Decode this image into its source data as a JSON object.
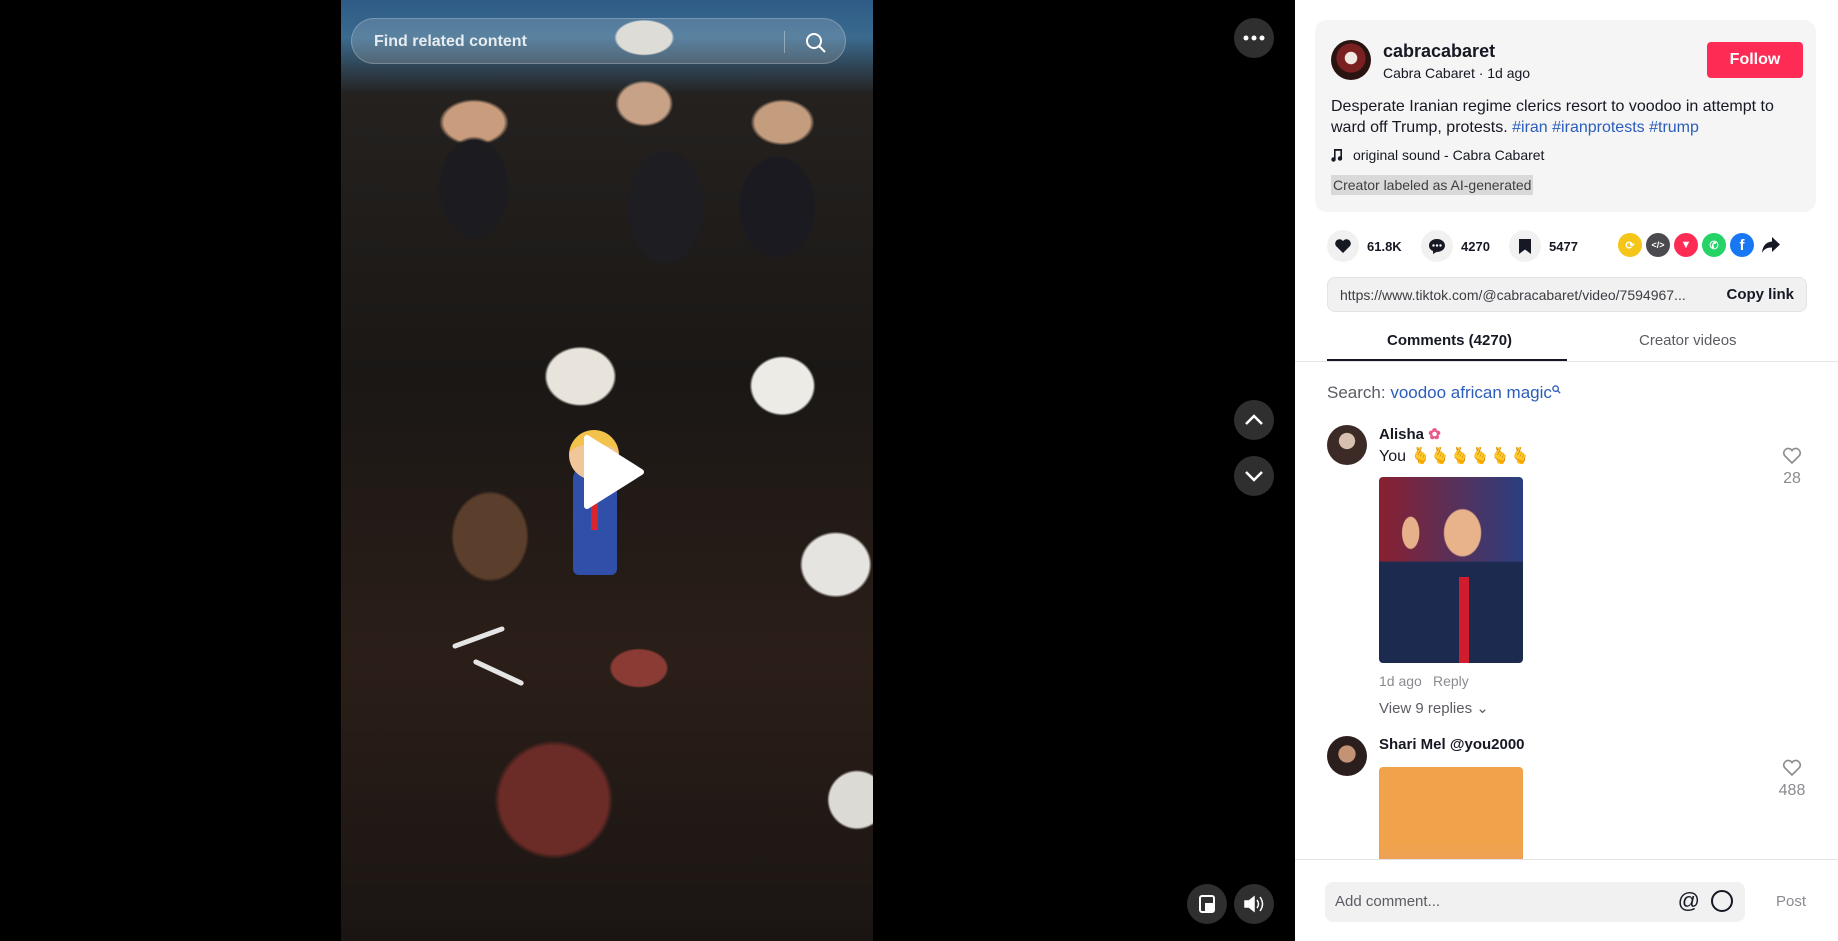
{
  "search": {
    "placeholder": "Find related content"
  },
  "post": {
    "username": "cabracabaret",
    "meta": "Cabra Cabaret · 1d ago",
    "follow_label": "Follow",
    "desc_text": "Desperate Iranian regime clerics resort to voodoo in attempt to ward off Trump, protests.",
    "tags": [
      "#iran",
      "#iranprotests",
      "#trump"
    ],
    "music": "original sound - Cabra Cabaret",
    "ai_label": "Creator labeled as AI-generated"
  },
  "stats": {
    "likes": "61.8K",
    "comments": "4270",
    "saves": "5477"
  },
  "share_icons": [
    {
      "name": "repost-icon",
      "color": "#f5c518",
      "glyph": "⟳"
    },
    {
      "name": "embed-icon",
      "color": "#4a4a4f",
      "glyph": "</>"
    },
    {
      "name": "send-icon",
      "color": "#fe2c55",
      "glyph": "▼"
    },
    {
      "name": "whatsapp-icon",
      "color": "#25d366",
      "glyph": "✆"
    },
    {
      "name": "facebook-icon",
      "color": "#1877f2",
      "glyph": "f"
    }
  ],
  "link": {
    "url": "https://www.tiktok.com/@cabracabaret/video/7594967...",
    "copy_label": "Copy link"
  },
  "tabs": {
    "comments": "Comments (4270)",
    "creator": "Creator videos"
  },
  "search_line": {
    "prefix": "Search: ",
    "query": "voodoo african magic"
  },
  "comments": [
    {
      "name": "Alisha",
      "text": "You 🫰🫰🫰🫰🫰🫰",
      "time": "1d ago",
      "reply": "Reply",
      "replies": "View 9 replies",
      "likes": "28"
    },
    {
      "name": "Shari Mel @you2000",
      "likes": "488"
    }
  ],
  "composer": {
    "placeholder": "Add comment...",
    "post_label": "Post"
  }
}
